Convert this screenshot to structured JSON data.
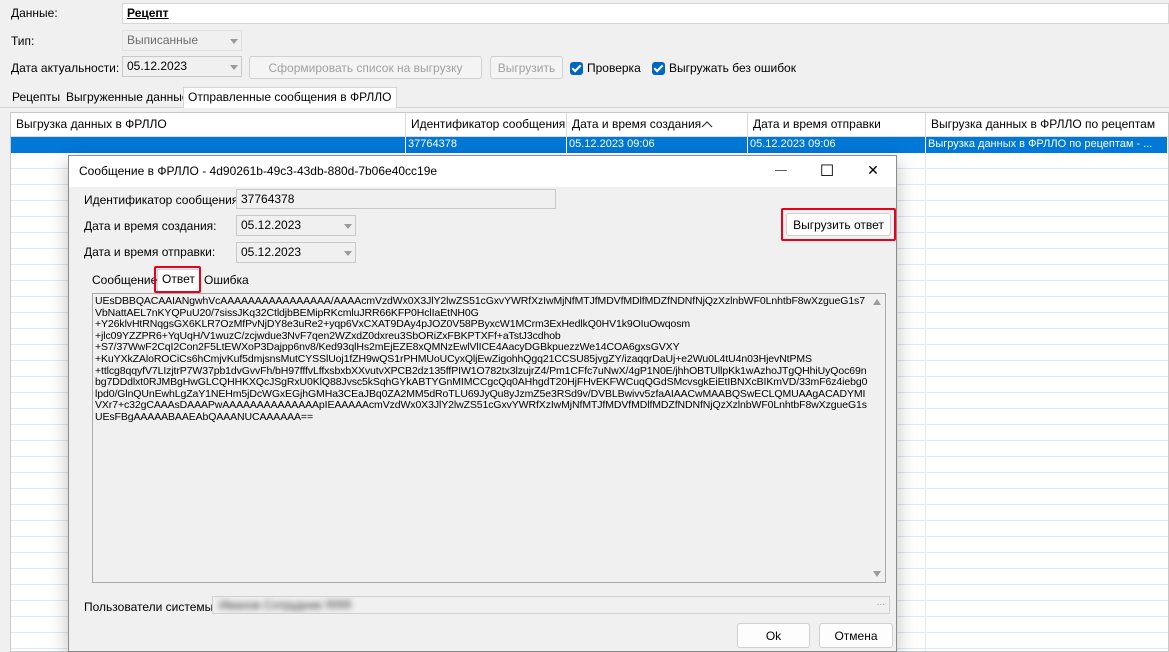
{
  "form": {
    "data_label": "Данные:",
    "data_value": "Рецепт",
    "type_label": "Тип:",
    "type_value": "Выписанные",
    "date_label": "Дата актуальности:",
    "date_value": "05.12.2023",
    "form_list_button": "Сформировать список на выгрузку",
    "upload_button": "Выгрузить",
    "check_label": "Проверка",
    "check_checked": true,
    "no_errors_label": "Выгружать без ошибок",
    "no_errors_checked": true
  },
  "tabs": [
    {
      "label": "Рецепты",
      "active": false
    },
    {
      "label": "Выгруженные данные",
      "active": false
    },
    {
      "label": "Отправленные сообщения в ФРЛЛО",
      "active": true
    }
  ],
  "grid": {
    "columns": [
      "Выгрузка данных в ФРЛЛО",
      "Идентификатор сообщения...",
      "Дата и время создания",
      "Дата и время отправки",
      "Выгрузка данных в ФРЛЛО по рецептам"
    ],
    "sorted_column_icon": "sort-ascending-icon",
    "selected_row": [
      "",
      "37764378",
      "05.12.2023 09:06",
      "05.12.2023 09:06",
      "Выгрузка данных в ФРЛЛО по рецептам - ..."
    ]
  },
  "dialog": {
    "title": "Сообщение в ФРЛЛО - 4d90261b-49c3-43db-880d-7b06e40cc19e",
    "minimize_glyph": "—",
    "maximize_glyph": "☐",
    "close_glyph": "✕",
    "id_label": "Идентификатор сообщения:",
    "id_value": "37764378",
    "created_label": "Дата и время создания:",
    "created_value": "05.12.2023",
    "sent_label": "Дата и время отправки:",
    "sent_value": "05.12.2023",
    "export_answer_button": "Выгрузить ответ",
    "tabs": [
      {
        "label": "Сообщение",
        "active": false
      },
      {
        "label": "Ответ",
        "active": true
      },
      {
        "label": "Ошибка",
        "active": false
      }
    ],
    "response_text": "UEsDBBQACAAIANgwhVcAAAAAAAAAAAAAAAA/AAAAcmVzdWx0X3JlY2lwZS51cGxvYWRfXzIwMjNfMTJfMDVfMDlfMDZfNDNfNjQzXzlnbWF0LnhtbF8wXzgueG1s7VbNattAEL7nKYQPuU20/7sissJKq32CtldjbBEMipRKcmluJRR66KFP0HclIaEtNH0G\n+Y26klvHtRNqgsGX6KLR7OzMfPvNjDY8e3uRe2+yqp6VxCXAT9DAy4pJOZ0V58PByxcW1MCrm3ExHedlkQ0HV1k9OIuOwqosm\n+jlc09YZZPR6+YqUqH/V1wuzC/zcjwdue3NvF7qen2WZxdZ0dxreu3SbORiZxFBKPTXFf+aTstJ3cdhob\n+S7/37WwF2CqI2Con2F5LtEWXoP3Dajpp6nv8/Ked93qlHs2mEjEZE8xQMNzEwlVlICE4AacyDGBkpuezzWe14COA6gxsGVXY\n+KuYXkZAloROCiCs6hCmjvKuf5dmjsnsMutCYSSlUoj1fZH9wQS1rPHMUoUCyxQljEwZigohhQgq21CCSU85jvgZY/izaqqrDaUj+e2Wu0L4tU4n03HjevNtPMS\n+ttlcg8qqyfV7LIzjtrP7W37pb1dvGvvFh/bH97fffvLffxsbxbXXvutvXPCB2dz135ffPIW1O782tx3lzujrZ4/Pm1CFfc7uNwX/4gP1N0E/jhhOBTUllpKk1wAzhoJTgQHhiUyQoc69nbg7DDdlxt0RJMBgHwGLCQHHKXQcJSgRxU0KlQ88Jvsc5kSqhGYkABTYGnMIMCCgcQq0AHhgdT20HjFHvEKFWCuqQGdSMcvsgkEiEtIBNXcBIKmVD/33mF6z4iebg0lpd0/GlnQUnEwhLgZaY1NEHm5jDcWGxEGjhGMHa3CEaJBq0ZA2MM5dRoTLU69JyQu8yJzmZ5e3RSd9v/DVBLBwivv5zfaAIAACwMAABQSwECLQMUAAgACADYMIVXr7+c32gCAAAsDAAAPwAAAAAAAAAAAAAApIEAAAAAcmVzdWx0X3JlY2lwZS51cGxvYWRfXzIwMjNfMTJfMDVfMDlfMDZfNDNfNjQzXzlnbWF0LnhtbF8wXzgueG1sUEsFBgAAAAABAAEAbQAAANUCAAAAAA==",
    "users_label": "Пользователи системы:",
    "users_value": "Иванов Сотрудник ЯЯЯ",
    "ok_button": "Ok",
    "cancel_button": "Отмена"
  },
  "colors": {
    "selection": "#0078d7",
    "highlight_border": "#e8001c",
    "checkbox": "#0067c0"
  }
}
